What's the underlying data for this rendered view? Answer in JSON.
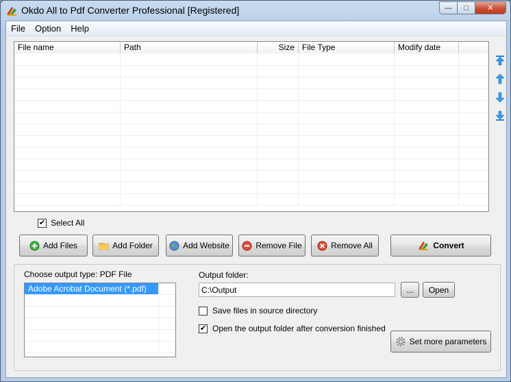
{
  "window": {
    "title": "Okdo All to Pdf Converter Professional [Registered]",
    "buttons": {
      "minimize": "—",
      "maximize": "□",
      "close": "✕"
    }
  },
  "menu": [
    "File",
    "Option",
    "Help"
  ],
  "filelist": {
    "columns": [
      "File name",
      "Path",
      "Size",
      "File Type",
      "Modify date"
    ]
  },
  "side_arrows": [
    "move-top-icon",
    "move-up-icon",
    "move-down-icon",
    "move-bottom-icon"
  ],
  "select_all": {
    "label": "Select All",
    "checked": true
  },
  "buttons": {
    "add_files": "Add Files",
    "add_folder": "Add Folder",
    "add_website": "Add Website",
    "remove_file": "Remove File",
    "remove_all": "Remove All",
    "convert": "Convert"
  },
  "output": {
    "type_label": "Choose output type:  PDF File",
    "types": [
      "Adobe Acrobat Document (*.pdf)"
    ],
    "folder_label": "Output folder:",
    "folder_value": "C:\\Output",
    "browse": "...",
    "open": "Open",
    "save_in_source": {
      "label": "Save files in source directory",
      "checked": false
    },
    "open_after": {
      "label": "Open the output folder after conversion finished",
      "checked": true
    },
    "more_params": "Set more parameters"
  }
}
